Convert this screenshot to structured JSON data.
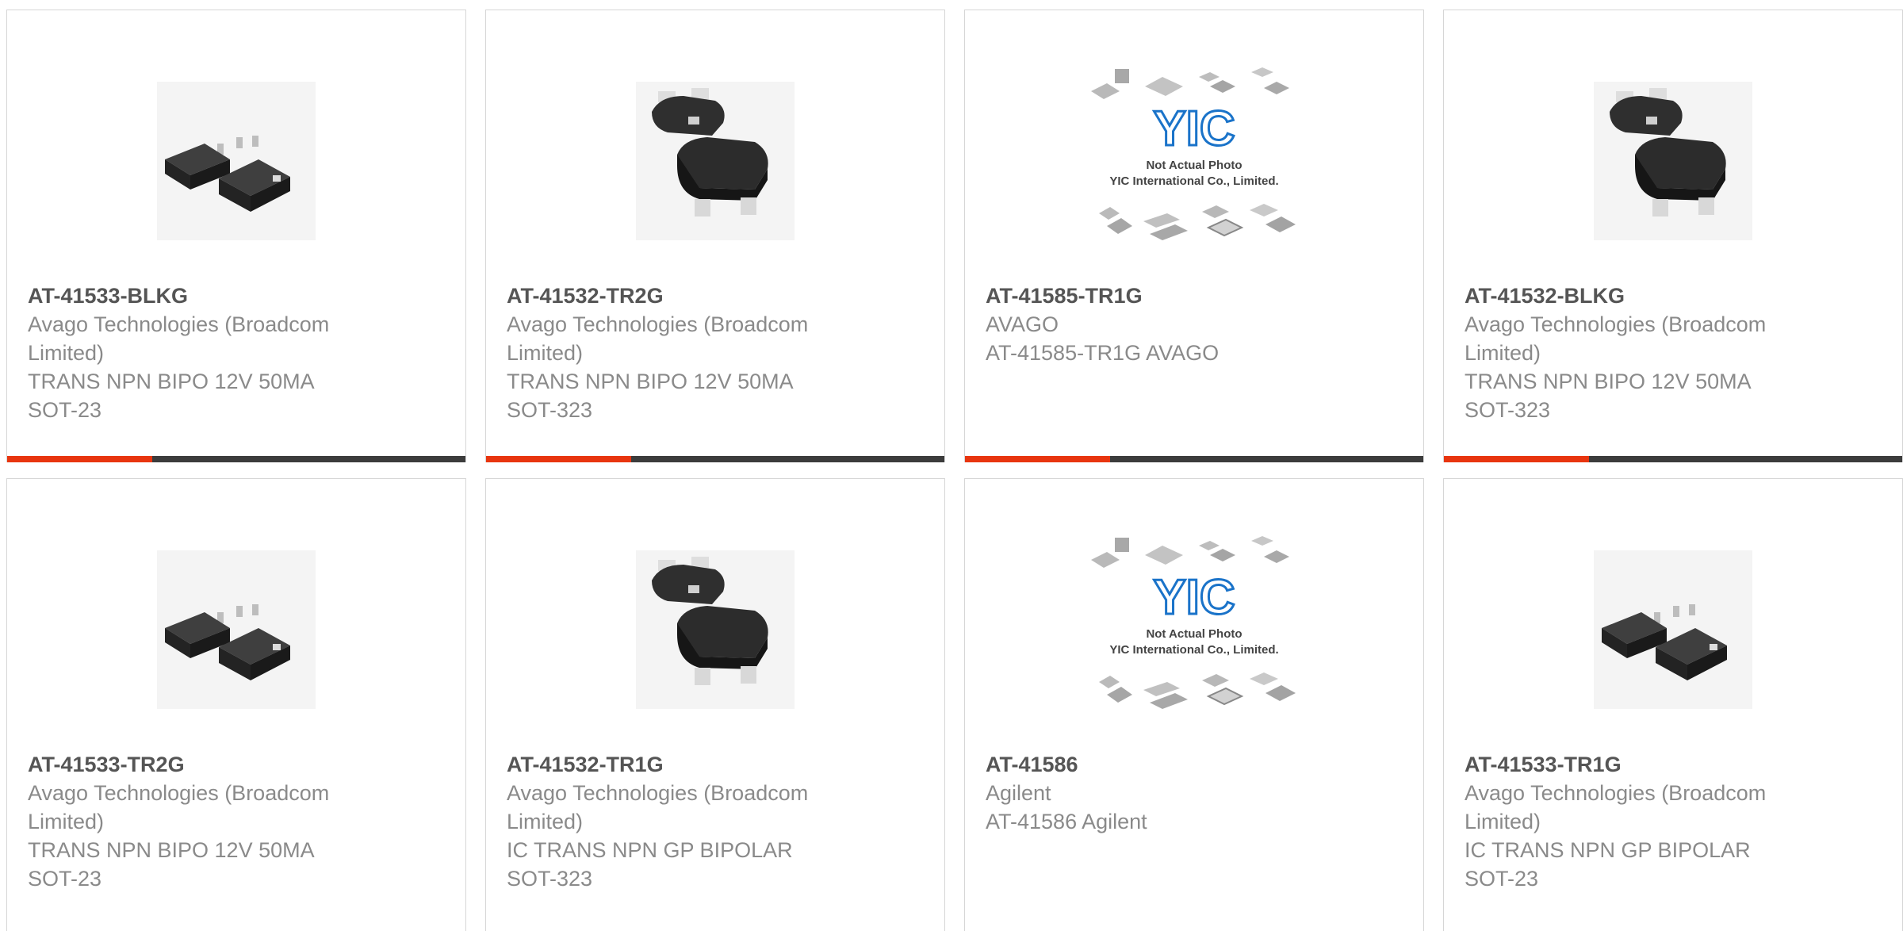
{
  "products": [
    {
      "part_number": "AT-41533-BLKG",
      "manufacturer": "Avago Technologies (Broadcom Limited)",
      "description": "TRANS NPN BIPO 12V 50MA SOT-23",
      "manufacturer_lines": [
        "Avago Technologies (Broadcom",
        "Limited)"
      ],
      "description_lines": [
        "TRANS NPN BIPO 12V 50MA",
        "SOT-23"
      ],
      "image_icon": "sot-23-package-icon"
    },
    {
      "part_number": "AT-41532-TR2G",
      "manufacturer": "Avago Technologies (Broadcom Limited)",
      "description": "TRANS NPN BIPO 12V 50MA SOT-323",
      "manufacturer_lines": [
        "Avago Technologies (Broadcom",
        "Limited)"
      ],
      "description_lines": [
        "TRANS NPN BIPO 12V 50MA",
        "SOT-323"
      ],
      "image_icon": "sot-323-package-icon"
    },
    {
      "part_number": "AT-41585-TR1G",
      "manufacturer": "AVAGO",
      "description": "AT-41585-TR1G AVAGO",
      "manufacturer_lines": [
        "AVAGO"
      ],
      "description_lines": [
        "AT-41585-TR1G AVAGO"
      ],
      "image_icon": "not-actual-photo-placeholder",
      "placeholder_logo": "YIC",
      "placeholder_line1": "Not Actual Photo",
      "placeholder_line2": "YIC International Co., Limited."
    },
    {
      "part_number": "AT-41532-BLKG",
      "manufacturer": "Avago Technologies (Broadcom Limited)",
      "description": "TRANS NPN BIPO 12V 50MA SOT-323",
      "manufacturer_lines": [
        "Avago Technologies (Broadcom",
        "Limited)"
      ],
      "description_lines": [
        "TRANS NPN BIPO 12V 50MA",
        "SOT-323"
      ],
      "image_icon": "sot-323-package-icon"
    },
    {
      "part_number": "AT-41533-TR2G",
      "manufacturer": "Avago Technologies (Broadcom Limited)",
      "description": "TRANS NPN BIPO 12V 50MA SOT-23",
      "manufacturer_lines": [
        "Avago Technologies (Broadcom",
        "Limited)"
      ],
      "description_lines": [
        "TRANS NPN BIPO 12V 50MA",
        "SOT-23"
      ],
      "image_icon": "sot-23-package-icon"
    },
    {
      "part_number": "AT-41532-TR1G",
      "manufacturer": "Avago Technologies (Broadcom Limited)",
      "description": "IC TRANS NPN GP BIPOLAR SOT-323",
      "manufacturer_lines": [
        "Avago Technologies (Broadcom",
        "Limited)"
      ],
      "description_lines": [
        "IC TRANS NPN GP BIPOLAR",
        "SOT-323"
      ],
      "image_icon": "sot-323-package-icon"
    },
    {
      "part_number": "AT-41586",
      "manufacturer": "Agilent",
      "description": "AT-41586 Agilent",
      "manufacturer_lines": [
        "Agilent"
      ],
      "description_lines": [
        "AT-41586 Agilent"
      ],
      "image_icon": "not-actual-photo-placeholder",
      "placeholder_logo": "YIC",
      "placeholder_line1": "Not Actual Photo",
      "placeholder_line2": "YIC International Co., Limited."
    },
    {
      "part_number": "AT-41533-TR1G",
      "manufacturer": "Avago Technologies (Broadcom Limited)",
      "description": "IC TRANS NPN GP BIPOLAR SOT-23",
      "manufacturer_lines": [
        "Avago Technologies (Broadcom",
        "Limited)"
      ],
      "description_lines": [
        "IC TRANS NPN GP BIPOLAR",
        "SOT-23"
      ],
      "image_icon": "sot-23-package-icon"
    }
  ],
  "colors": {
    "accent": "#e8350f",
    "bar": "#3c3c3c",
    "part_number_text": "#555555",
    "body_text": "#8a8a8a",
    "card_border": "#d6d6d6",
    "yic_logo": "#1a73c9"
  }
}
